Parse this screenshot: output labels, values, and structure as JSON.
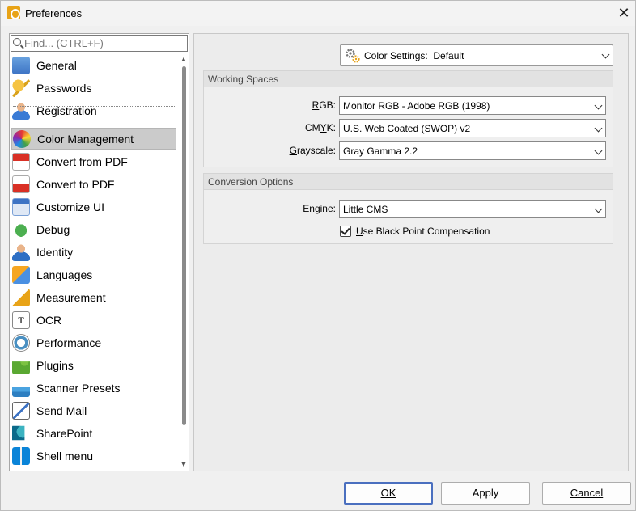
{
  "window": {
    "title": "Preferences",
    "close_label": "✕"
  },
  "sidebar": {
    "search_placeholder": "Find... (CTRL+F)",
    "items": [
      {
        "label": "General",
        "icon": "general-icon"
      },
      {
        "label": "Passwords",
        "icon": "key-icon"
      },
      {
        "label": "Registration",
        "icon": "registration-icon"
      },
      {
        "label": "Color Management",
        "icon": "color-wheel-icon",
        "selected": true
      },
      {
        "label": "Convert from PDF",
        "icon": "convert-from-pdf-icon"
      },
      {
        "label": "Convert to PDF",
        "icon": "convert-to-pdf-icon"
      },
      {
        "label": "Customize UI",
        "icon": "customize-ui-icon"
      },
      {
        "label": "Debug",
        "icon": "bug-icon"
      },
      {
        "label": "Identity",
        "icon": "identity-icon"
      },
      {
        "label": "Languages",
        "icon": "languages-icon"
      },
      {
        "label": "Measurement",
        "icon": "measurement-icon"
      },
      {
        "label": "OCR",
        "icon": "ocr-icon"
      },
      {
        "label": "Performance",
        "icon": "performance-icon"
      },
      {
        "label": "Plugins",
        "icon": "plugin-icon"
      },
      {
        "label": "Scanner Presets",
        "icon": "scanner-icon"
      },
      {
        "label": "Send Mail",
        "icon": "mail-icon"
      },
      {
        "label": "SharePoint",
        "icon": "sharepoint-icon"
      },
      {
        "label": "Shell menu",
        "icon": "windows-icon"
      }
    ]
  },
  "main": {
    "color_settings": {
      "label": "Color Settings:",
      "value": "Default"
    },
    "working_spaces": {
      "heading": "Working Spaces",
      "rgb": {
        "label": "RGB:",
        "value": "Monitor RGB - Adobe RGB (1998)"
      },
      "cmyk": {
        "label": "CMYK:",
        "value": "U.S. Web Coated (SWOP) v2"
      },
      "grayscale": {
        "label": "Grayscale:",
        "value": "Gray Gamma 2.2"
      }
    },
    "conversion_options": {
      "heading": "Conversion Options",
      "engine": {
        "label": "Engine:",
        "value": "Little CMS"
      },
      "black_point": {
        "label": "Use Black Point Compensation",
        "checked": true
      }
    }
  },
  "buttons": {
    "ok": "OK",
    "apply": "Apply",
    "cancel": "Cancel"
  },
  "colors": {
    "accent": "#4a6fbf",
    "selected_bg": "#cbcbcb"
  }
}
